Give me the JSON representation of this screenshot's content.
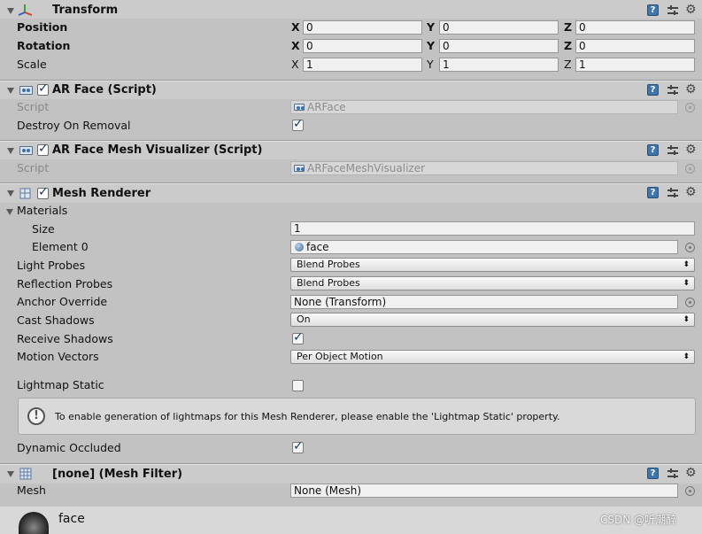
{
  "transform": {
    "title": "Transform",
    "rows": [
      {
        "label": "Position",
        "x": "0",
        "y": "0",
        "z": "0"
      },
      {
        "label": "Rotation",
        "x": "0",
        "y": "0",
        "z": "0"
      },
      {
        "label": "Scale",
        "x": "1",
        "y": "1",
        "z": "1"
      }
    ],
    "axis": {
      "x": "X",
      "y": "Y",
      "z": "Z"
    }
  },
  "ar_face": {
    "title": "AR Face (Script)",
    "script_label": "Script",
    "script_value": "ARFace",
    "destroy_label": "Destroy On Removal",
    "destroy_checked": true
  },
  "ar_face_mesh": {
    "title": "AR Face Mesh Visualizer (Script)",
    "script_label": "Script",
    "script_value": "ARFaceMeshVisualizer"
  },
  "mesh_renderer": {
    "title": "Mesh Renderer",
    "materials_label": "Materials",
    "size_label": "Size",
    "size_value": "1",
    "element0_label": "Element 0",
    "element0_value": "face",
    "light_probes_label": "Light Probes",
    "light_probes_value": "Blend Probes",
    "reflection_probes_label": "Reflection Probes",
    "reflection_probes_value": "Blend Probes",
    "anchor_override_label": "Anchor Override",
    "anchor_override_value": "None (Transform)",
    "cast_shadows_label": "Cast Shadows",
    "cast_shadows_value": "On",
    "receive_shadows_label": "Receive Shadows",
    "receive_shadows_checked": true,
    "motion_vectors_label": "Motion Vectors",
    "motion_vectors_value": "Per Object Motion",
    "lightmap_static_label": "Lightmap Static",
    "lightmap_static_checked": false,
    "info_text": "To enable generation of lightmaps for this Mesh Renderer, please enable the 'Lightmap Static' property.",
    "dynamic_occluded_label": "Dynamic Occluded",
    "dynamic_occluded_checked": true
  },
  "mesh_filter": {
    "title": "[none] (Mesh Filter)",
    "mesh_label": "Mesh",
    "mesh_value": "None (Mesh)"
  },
  "footer": {
    "material_name": "face",
    "watermark": "CSDN @听潮醉"
  },
  "icons": {
    "help": "help-book-icon",
    "presets": "preset-sliders-icon",
    "settings": "gear-icon",
    "object_picker": "object-picker-icon",
    "dropdown": "dropdown-arrow-icon"
  },
  "colors": {
    "panel_bg": "#c2c2c2",
    "header_bg": "#cbcbcb",
    "field_bg": "#f0f0f0",
    "help_blue": "#3e75ad"
  }
}
